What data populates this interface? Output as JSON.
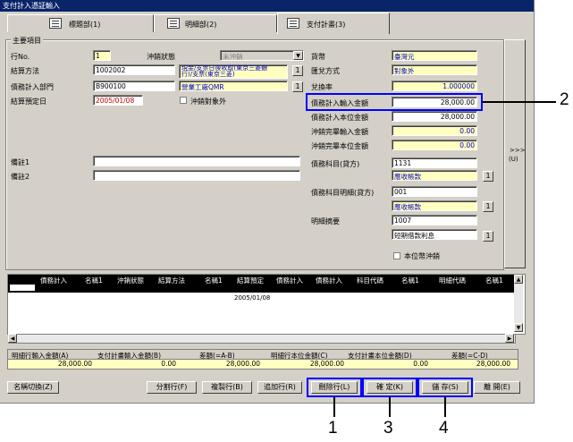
{
  "window": {
    "title": "支付計入憑証輸入"
  },
  "tabs": [
    {
      "label": "標題部(1)"
    },
    {
      "label": "明細部(2)"
    },
    {
      "label": "支付計畫(3)"
    }
  ],
  "group_title": "主要項目",
  "left": {
    "row_no_label": "行No.",
    "row_no_value": "1",
    "status_label": "沖銷狀態",
    "status_value": "未沖銷",
    "settle_label": "結算方法",
    "settle_code": "1002002",
    "settle_name": "現金/支票日後收取(東京三菱銀",
    "settle_name2": "行)/支票(東京三菱)",
    "dept_label": "債務計入部門",
    "dept_code": "B900100",
    "dept_name": "營業工廠QMR",
    "due_label": "結算預定日",
    "due_value": "2005/01/08",
    "offset_label": "沖銷對象外",
    "note1_label": "備註1",
    "note2_label": "備註2"
  },
  "right": {
    "currency_label": "貨幣",
    "currency_value": "臺灣元",
    "exchange_label": "匯兌方式",
    "exchange_value": "對象外",
    "rate_label": "兌換率",
    "rate_value": "1.000000",
    "debt_input_label": "債務計入輸入金額",
    "debt_input_value": "28,000.00",
    "debt_base_label": "債務計入本位金額",
    "debt_base_value": "28,000.00",
    "offset_done_input_label": "沖銷完畢輸入金額",
    "offset_done_input_value": "0.00",
    "offset_done_base_label": "沖銷完畢本位金額",
    "offset_done_base_value": "0.00",
    "subject_label": "債務科目(貸方)",
    "subject_code": "1131",
    "subject_name": "應收帳款",
    "subject_detail_label": "債務科目明細(貸方)",
    "subject_detail_code": "001",
    "subject_detail_name": "應收帳款",
    "summary_label": "明細摘要",
    "summary_code": "1007",
    "summary_name": "短期借款利息",
    "local_offset_label": "本位幣沖銷",
    "side_button": ">>>",
    "side_button2": "(U)",
    "ref_btn": "1"
  },
  "grid": {
    "headers": [
      "債務計入",
      "名稱1",
      "沖銷狀態",
      "結算方法",
      "名稱1",
      "結算預定",
      "債務計入",
      "債務計入",
      "科目代碼",
      "名稱1",
      "明細代碼",
      "名稱1"
    ],
    "row_date": "2005/01/08"
  },
  "summary": {
    "headers": [
      "明細行輸入金額(A)",
      "支付計畫輸入金額(B)",
      "差額(=A-B)",
      "明細行本位金額(C)",
      "支付計畫本位金額(D)",
      "差額(=C-D)"
    ],
    "values": [
      "28,000.00",
      "0.00",
      "28,000.00",
      "28,000.00",
      "0.00",
      "28,000.00"
    ]
  },
  "buttons": {
    "name_switch": "名稱切換(Z)",
    "split": "分割行(F)",
    "copy": "複製行(B)",
    "append": "追加行(R)",
    "delete": "刪除行(L)",
    "confirm": "確 定(K)",
    "save": "儲 存(S)",
    "close": "離 開(E)"
  },
  "callouts": [
    "1",
    "2",
    "3",
    "4"
  ],
  "colors": {
    "highlight": "#0000ff",
    "title_bar": "#0a246a",
    "field_yellow": "#ffffc0"
  }
}
